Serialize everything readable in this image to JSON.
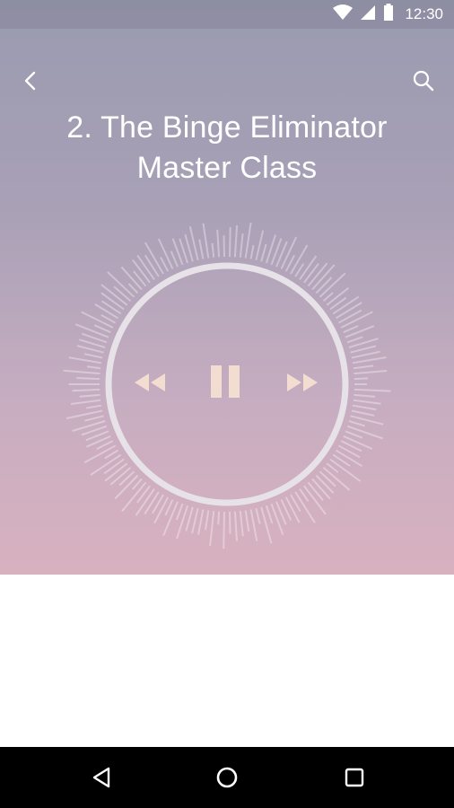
{
  "status_bar": {
    "time": "12:30",
    "icons": [
      "wifi-icon",
      "cell-signal-icon",
      "battery-icon"
    ]
  },
  "header": {
    "back_icon": "chevron-left-icon",
    "search_icon": "search-icon"
  },
  "track": {
    "title_line1": "2. The Binge Eliminator",
    "title_line2": "Master Class"
  },
  "player": {
    "state": "playing",
    "controls": [
      "rewind-icon",
      "pause-icon",
      "fast-forward-icon"
    ],
    "control_color": "#f3dcd0",
    "ring_color": "#e6e2e8"
  },
  "theme": {
    "gradient_top": "#9a9bb0",
    "gradient_bottom": "#d8b1bf"
  },
  "nav_bar": {
    "buttons": [
      "back-triangle-icon",
      "home-circle-icon",
      "recents-square-icon"
    ]
  }
}
